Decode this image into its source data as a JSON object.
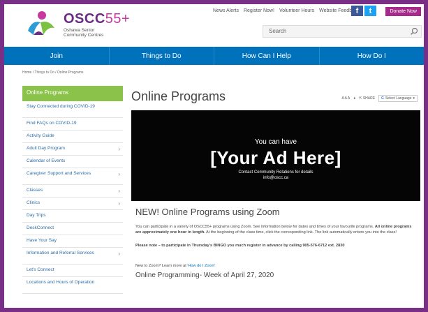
{
  "header": {
    "logo_main": "OSCC",
    "logo_suffix": "55+",
    "logo_sub1": "Oshawa Senior",
    "logo_sub2": "Community Centres",
    "top_links": [
      "News Alerts",
      "Register Now!",
      "Volunteer Hours",
      "Website Feedback"
    ],
    "social": {
      "facebook": "f",
      "twitter": "t"
    },
    "donate": "Donate Now",
    "search_placeholder": "Search"
  },
  "nav": [
    "Join",
    "Things to Do",
    "How Can I Help",
    "How Do I"
  ],
  "breadcrumb": "Home / Things to Do / Online Programs",
  "sidebar": {
    "heading": "Online Programs",
    "items": [
      {
        "label": "Stay Connected during COVID-19",
        "chevron": false
      },
      {
        "label": "Find FAQs on COVID-19",
        "chevron": false
      },
      {
        "label": "Activity Guide",
        "chevron": false
      },
      {
        "label": "Adult Day Program",
        "chevron": true
      },
      {
        "label": "Calendar of Events",
        "chevron": false
      },
      {
        "label": "Caregiver Support and Services",
        "chevron": true
      },
      {
        "label": "Classes",
        "chevron": true
      },
      {
        "label": "Clinics",
        "chevron": true
      },
      {
        "label": "Day Trips",
        "chevron": false
      },
      {
        "label": "DeskConnect",
        "chevron": false
      },
      {
        "label": "Have Your Say",
        "chevron": false
      },
      {
        "label": "Information and Referral Services",
        "chevron": true
      },
      {
        "label": "Let's Connect",
        "chevron": false
      },
      {
        "label": "Locations and Hours of Operation",
        "chevron": false
      }
    ]
  },
  "main": {
    "title": "Online Programs",
    "tools": {
      "text_size": "A A A",
      "share": "SHARE",
      "language": "Select Language"
    },
    "ad": {
      "line1": "You can have",
      "line2": "[Your Ad Here]",
      "line3": "Contact Community Relations for details",
      "line4": "info@oscc.ca"
    },
    "zoom_heading": "NEW! Online Programs using Zoom",
    "para1_a": "You can participate in a variety of OSCC55+ programs using Zoom. See information below for dates and times of your favourite programs. ",
    "para1_b": "All online programs are approximately one hour in length.",
    "para1_c": " At the beginning of the class time, click the corresponding link. The link automatically enters you into the class!",
    "para2": "Please note – to participate in Thursday's BINGO you much register in advance by calling 905-576-6712 ext. 2830",
    "para3_a": "New to Zoom? Learn more at ",
    "para3_link": "'How do I Zoom'",
    "week_heading": "Online Programming- Week of April 27, 2020"
  },
  "colors": {
    "nav": "#0072bc",
    "sidebar_head": "#8bc34a",
    "brand": "#6b2d83",
    "frame": "#7a2f86"
  }
}
